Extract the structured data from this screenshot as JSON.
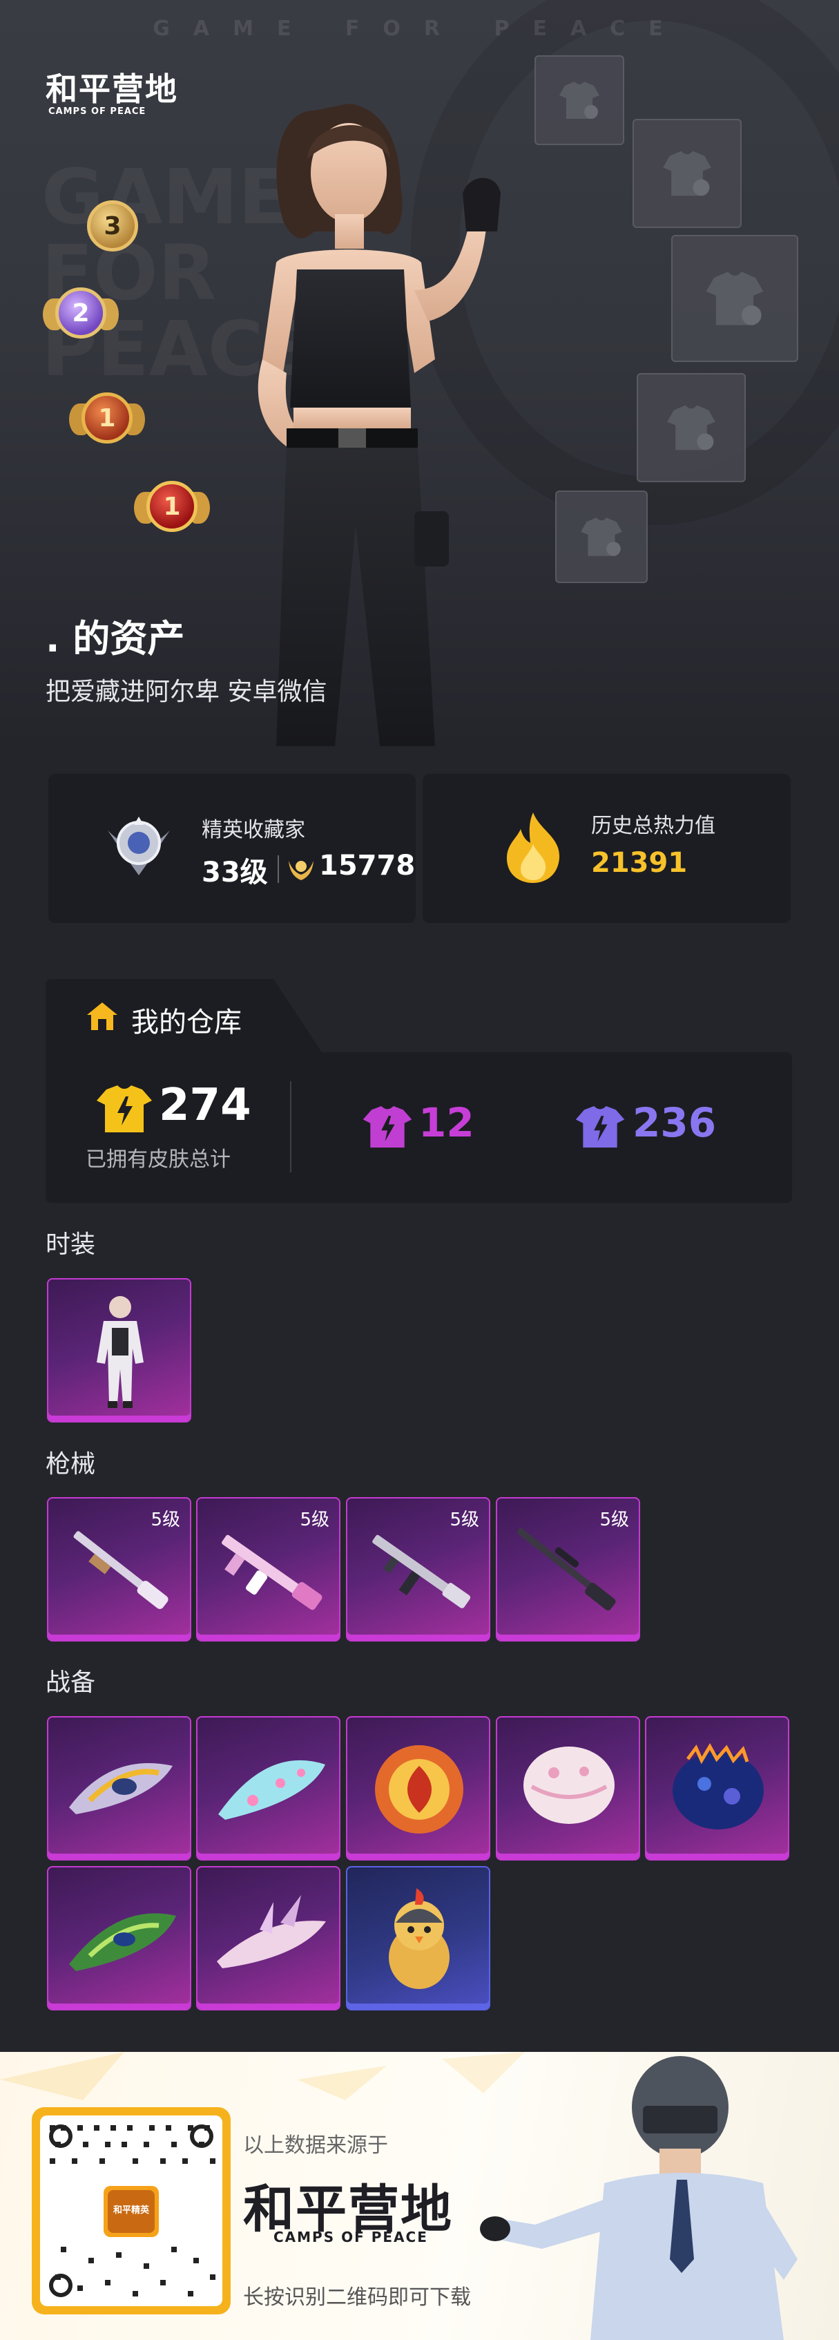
{
  "hero": {
    "tagline": "GAME FOR PEACE",
    "logo_cn": "和平营地",
    "logo_en": "CAMPS OF PEACE",
    "bg_word": "GAME FOR PEACE",
    "player_name": ". 的资产",
    "player_sub": "把爱藏进阿尔卑  安卓微信",
    "medals": [
      {
        "icon": "rank-medal-icon",
        "number": "3"
      },
      {
        "icon": "rank-medal-icon",
        "number": "2"
      },
      {
        "icon": "rank-medal-icon",
        "number": "1"
      },
      {
        "icon": "rank-medal-icon",
        "number": "1"
      }
    ]
  },
  "stats": {
    "collector": {
      "icon": "collector-badge-icon",
      "title": "精英收藏家",
      "level": "33级",
      "points_icon": "laurel-icon",
      "points": "15778"
    },
    "heat": {
      "icon": "flame-icon",
      "title": "历史总热力值",
      "value": "21391"
    }
  },
  "warehouse": {
    "title": "我的仓库",
    "icon": "house-icon",
    "total": "274",
    "total_label": "已拥有皮肤总计",
    "purple_count": "12",
    "blue_count": "236",
    "colors": {
      "gold": "#f5c21a",
      "purple": "#c03fd2",
      "blue": "#7f6ae8"
    }
  },
  "sections": {
    "fashion": "时装",
    "guns": "枪械",
    "gear": "战备"
  },
  "guns": [
    {
      "level": "5级"
    },
    {
      "level": "5级"
    },
    {
      "level": "5级"
    },
    {
      "level": "5级"
    }
  ],
  "footer": {
    "source": "以上数据来源于",
    "logo_cn": "和平营地",
    "logo_en": "CAMPS OF PEACE",
    "download": "长按识别二维码即可下载",
    "qr_logo": "和平精英"
  }
}
